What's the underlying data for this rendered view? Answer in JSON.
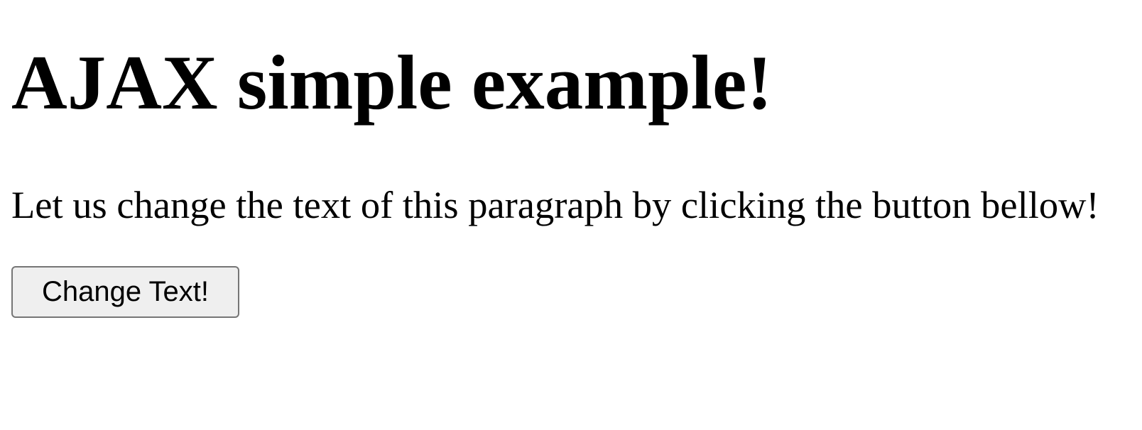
{
  "page": {
    "title": "AJAX simple example!",
    "paragraph": "Let us change the text of this paragraph by clicking the button bellow!",
    "button_label": "Change Text!"
  }
}
